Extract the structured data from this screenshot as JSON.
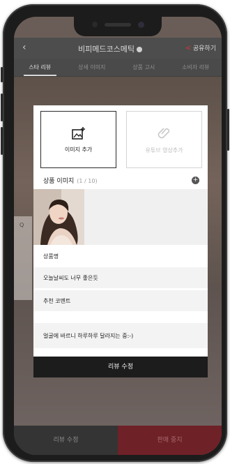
{
  "header": {
    "back_icon": "back-arrow-icon",
    "title": "비피메드코스메틱",
    "share_label": "공유하기"
  },
  "tabs": [
    {
      "label": "스타 리뷰",
      "active": true
    },
    {
      "label": "상세 이미지",
      "active": false
    },
    {
      "label": "상품 고시",
      "active": false
    },
    {
      "label": "소비자 리뷰",
      "active": false
    }
  ],
  "background": {
    "side_label": "Q"
  },
  "modal": {
    "add_image_label": "이미지 추가",
    "add_video_label": "유튜브 영상추가",
    "section_title": "상품 이미지",
    "section_count": "(1 / 10)",
    "product_name_label": "상품명",
    "review_title": "오늘날씨도 너무 좋은듯",
    "recommend_comment": "추천 코멘트",
    "review_body": "얼굴에 바르니 하루하루 달라지는 중:-)",
    "submit_label": "리뷰 수정"
  },
  "bottom_bar": {
    "left_label": "리뷰 수정",
    "right_label": "판매 중지"
  },
  "colors": {
    "accent": "#6e2127",
    "dark": "#1c1c1c"
  }
}
